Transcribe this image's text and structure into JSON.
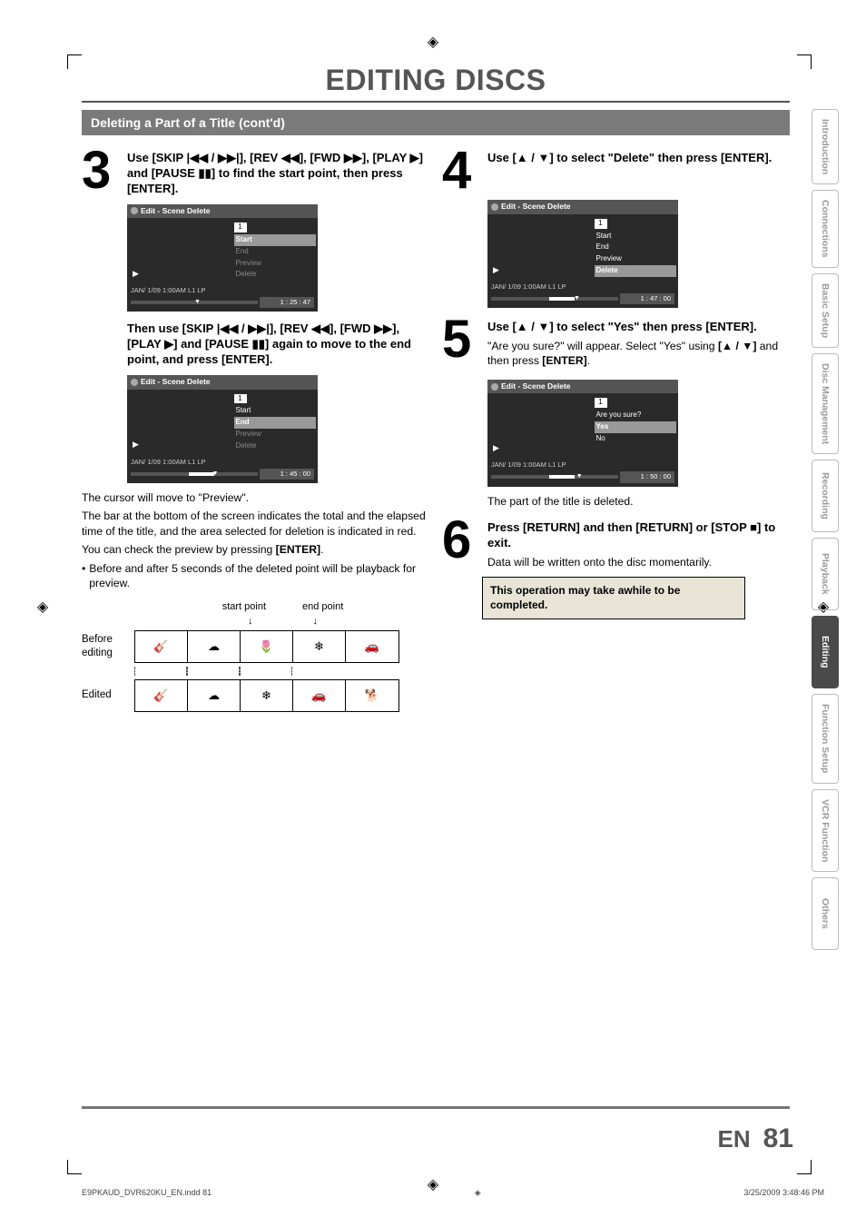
{
  "page": {
    "title": "EDITING DISCS",
    "section_bar": "Deleting a Part of a Title (cont'd)",
    "en_label": "EN",
    "page_number": "81",
    "footer_left": "E9PKAUD_DVR620KU_EN.indd   81",
    "footer_right": "3/25/2009   3:48:46 PM"
  },
  "tabs": [
    "Introduction",
    "Connections",
    "Basic Setup",
    "Disc Management",
    "Recording",
    "Playback",
    "Editing",
    "Function Setup",
    "VCR Function",
    "Others"
  ],
  "active_tab_index": 6,
  "left": {
    "step3": {
      "num": "3",
      "head": "Use [SKIP |◀◀ / ▶▶|], [REV ◀◀], [FWD ▶▶], [PLAY ▶] and [PAUSE ▮▮] to find the start point, then press [ENTER].",
      "dialog1": {
        "title": "Edit - Scene Delete",
        "menu_num": "1",
        "items": [
          {
            "label": "Start",
            "state": "hl"
          },
          {
            "label": "End",
            "state": "dim"
          },
          {
            "label": "Preview",
            "state": "dim"
          },
          {
            "label": "Delete",
            "state": "dim"
          }
        ],
        "rec": "JAN/ 1/09 1:00AM L1    LP",
        "time": "1 : 25 : 47"
      },
      "mid": "Then use [SKIP |◀◀ / ▶▶|], [REV ◀◀], [FWD ▶▶], [PLAY ▶] and [PAUSE ▮▮] again to move to the end point, and press [ENTER].",
      "dialog2": {
        "title": "Edit - Scene Delete",
        "menu_num": "1",
        "items": [
          {
            "label": "Start",
            "state": "active"
          },
          {
            "label": "End",
            "state": "hl"
          },
          {
            "label": "Preview",
            "state": "dim"
          },
          {
            "label": "Delete",
            "state": "dim"
          }
        ],
        "rec": "JAN/ 1/09 1:00AM L1    LP",
        "time": "1 : 45 : 00"
      },
      "p1": "The cursor will move to \"Preview\".",
      "p2": "The bar at the bottom of the screen indicates the total and the elapsed time of the title, and the area selected for deletion is indicated in red.",
      "p3_pre": "You can check the preview by pressing ",
      "p3_bold": "[ENTER]",
      "p3_post": ".",
      "bullet": "Before and after 5 seconds of the deleted point will be playback for preview.",
      "diagram": {
        "start_label": "start point",
        "end_label": "end point",
        "before_label": "Before editing",
        "edited_label": "Edited"
      }
    }
  },
  "right": {
    "step4": {
      "num": "4",
      "head": "Use [▲ / ▼] to select \"Delete\" then press [ENTER].",
      "dialog": {
        "title": "Edit - Scene Delete",
        "menu_num": "1",
        "items": [
          {
            "label": "Start",
            "state": "active"
          },
          {
            "label": "End",
            "state": "active"
          },
          {
            "label": "Preview",
            "state": "active"
          },
          {
            "label": "Delete",
            "state": "hl"
          }
        ],
        "rec": "JAN/ 1/09 1:00AM L1    LP",
        "time": "1 : 47 : 00"
      }
    },
    "step5": {
      "num": "5",
      "head": "Use [▲ / ▼] to select \"Yes\" then press [ENTER].",
      "sub_pre": "\"Are you sure?\" will appear. Select \"Yes\" using ",
      "sub_bold": "[▲ / ▼]",
      "sub_mid": " and then press ",
      "sub_bold2": "[ENTER]",
      "sub_post": ".",
      "dialog": {
        "title": "Edit - Scene Delete",
        "menu_num": "1",
        "items": [
          {
            "label": "Are you sure?",
            "state": "active"
          },
          {
            "label": "Yes",
            "state": "hl"
          },
          {
            "label": "No",
            "state": "active"
          }
        ],
        "rec": "JAN/ 1/09 1:00AM L1    LP",
        "time": "1 : 50 : 00"
      },
      "tail": "The part of the title is deleted."
    },
    "step6": {
      "num": "6",
      "head": "Press [RETURN] and then [RETURN] or [STOP ■] to exit.",
      "sub": "Data will be written onto the disc momentarily.",
      "note": "This operation may take awhile to be completed."
    }
  }
}
